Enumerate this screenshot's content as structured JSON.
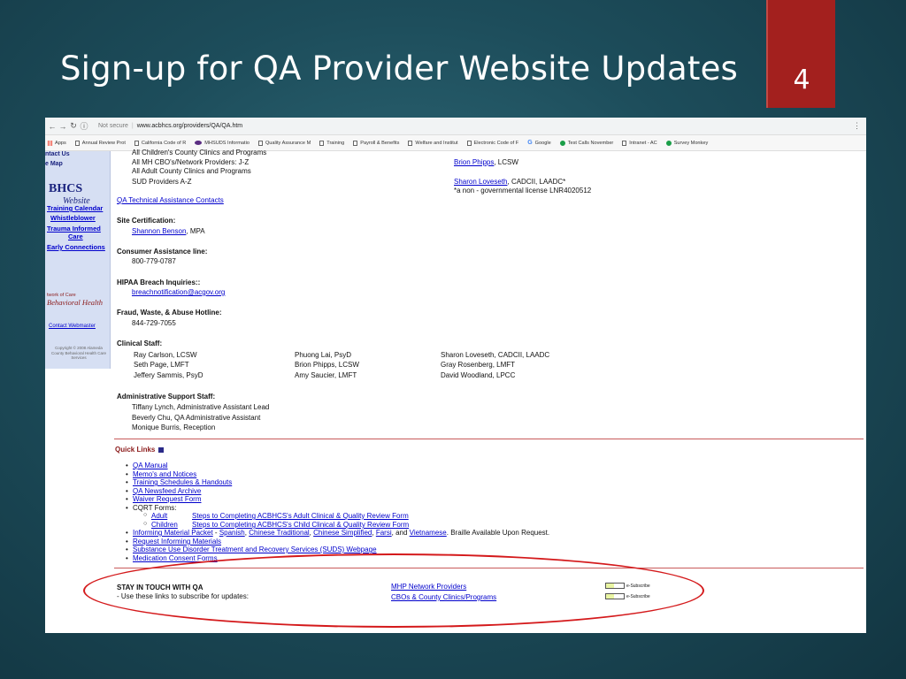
{
  "slide": {
    "title": "Sign-up for QA Provider Website Updates",
    "page_number": "4"
  },
  "browser": {
    "security_label": "Not secure",
    "url": "www.acbhcs.org/providers/QA/QA.htm",
    "bookmarks": [
      {
        "label": "Apps",
        "icon": "apps-icon"
      },
      {
        "label": "Annual Review Prot",
        "icon": "page-icon"
      },
      {
        "label": "California Code of R",
        "icon": "page-icon"
      },
      {
        "label": "MHSUDS Informatio",
        "icon": "eye-icon"
      },
      {
        "label": "Quality Assurance M",
        "icon": "page-icon"
      },
      {
        "label": "Training",
        "icon": "page-icon"
      },
      {
        "label": "Payroll & Benefits",
        "icon": "page-icon"
      },
      {
        "label": "Welfare and Institut",
        "icon": "page-icon"
      },
      {
        "label": "Electronic Code of F",
        "icon": "page-icon"
      },
      {
        "label": "Google",
        "icon": "google-icon"
      },
      {
        "label": "Test Calls November",
        "icon": "dot-icon"
      },
      {
        "label": "Intranet - AC",
        "icon": "page-icon"
      },
      {
        "label": "Survey Monkey",
        "icon": "dot-icon"
      }
    ]
  },
  "sidebar": {
    "contact_us": "ntact Us",
    "site_map": "e Map",
    "logo_big": "BHCS",
    "logo_small": "Website",
    "training_calendar": "Training Calendar",
    "whistleblower": "Whistleblower",
    "trauma_informed_1": "Trauma Informed",
    "trauma_informed_2": "Care",
    "early_connections": "Early Connections",
    "noc_line": "twork of Care",
    "noc_bh": "Behavioral Health",
    "contact_webmaster": "Contact Webmaster",
    "copyright": "Copyright © 2008 Alameda County Behavioral Health Care Services"
  },
  "content": {
    "providers_top": [
      "All Children's County Clinics and Programs",
      "All MH CBO's/Network Providers: J-Z",
      "All Adult County Clinics and Programs",
      "SUD Providers A-Z"
    ],
    "brion_phipps": "Brion Phipps",
    "brion_cred": ", LCSW",
    "sharon_loveseth": "Sharon Loveseth",
    "sharon_cred": ", CADCII, LAADC*",
    "license_note": "*a non - governmental license LNR4020512",
    "qa_ta_contacts": "QA Technical Assistance Contacts",
    "site_cert_heading": "Site Certification:",
    "site_cert_name": "Shannon Benson",
    "site_cert_cred": ", MPA",
    "consumer_heading": "Consumer Assistance line:",
    "consumer_phone": "800-779-0787",
    "hipaa_heading": "HIPAA Breach Inquiries::",
    "hipaa_email": "breachnotification@acgov.org",
    "fraud_heading": "Fraud, Waste, & Abuse Hotline:",
    "fraud_phone": "844-729-7055",
    "clinical_heading": "Clinical Staff:",
    "clinical_col1": [
      "Ray Carlson, LCSW",
      "Seth Page, LMFT",
      "Jeffery Sammis, PsyD"
    ],
    "clinical_col2": [
      "Phuong Lai, PsyD",
      "Brion Phipps, LCSW",
      "Amy Saucier, LMFT"
    ],
    "clinical_col3": [
      "Sharon Loveseth, CADCII, LAADC",
      "Gray Rosenberg, LMFT",
      "David Woodland, LPCC"
    ],
    "admin_heading": "Administrative Support Staff:",
    "admin_staff": [
      "Tiffany Lynch, Administrative Assistant Lead",
      "Beverly Chu, QA Administrative Assistant",
      "Monique Burris, Reception"
    ]
  },
  "quick_links": {
    "heading": "Quick Links",
    "qa_manual": "QA Manual",
    "memos": "Memo's and Notices",
    "training": "Training Schedules & Handouts",
    "newsfeed": "QA Newsfeed Archive",
    "waiver": "Waiver Request Form",
    "cqrt": "CQRT Forms:",
    "adult": "Adult",
    "adult_form": "Steps to Completing ACBHCS's Adult Clinical & Quality Review Form",
    "children": "Children",
    "child_form": "Steps to Completing ACBHCS's Child Clinical & Quality Review Form",
    "informing_packet": "Informing Material Packet",
    "dash": " - ",
    "spanish": "Spanish",
    "chinese_trad": "Chinese Traditional",
    "chinese_simp": "Chinese Simplified",
    "farsi": "Farsi",
    "and": ", and ",
    "comma": ", ",
    "vietnamese": "Vietnamese",
    "braille": ". Braille Available Upon Request.",
    "request_informing": "Request Informing Materials",
    "suds": "Substance Use Disorder Treatment and Recovery Services (SUDS) Webpage",
    "med_consent": "Medication Consent Forms"
  },
  "stay_in_touch": {
    "heading": "STAY IN TOUCH WITH QA",
    "subtext": "- Use these links to subscribe for updates:",
    "mhp_network": "MHP Network Providers",
    "cbos": "CBOs & County Clinics/Programs",
    "esubscribe_label": "e-Subscribe"
  }
}
